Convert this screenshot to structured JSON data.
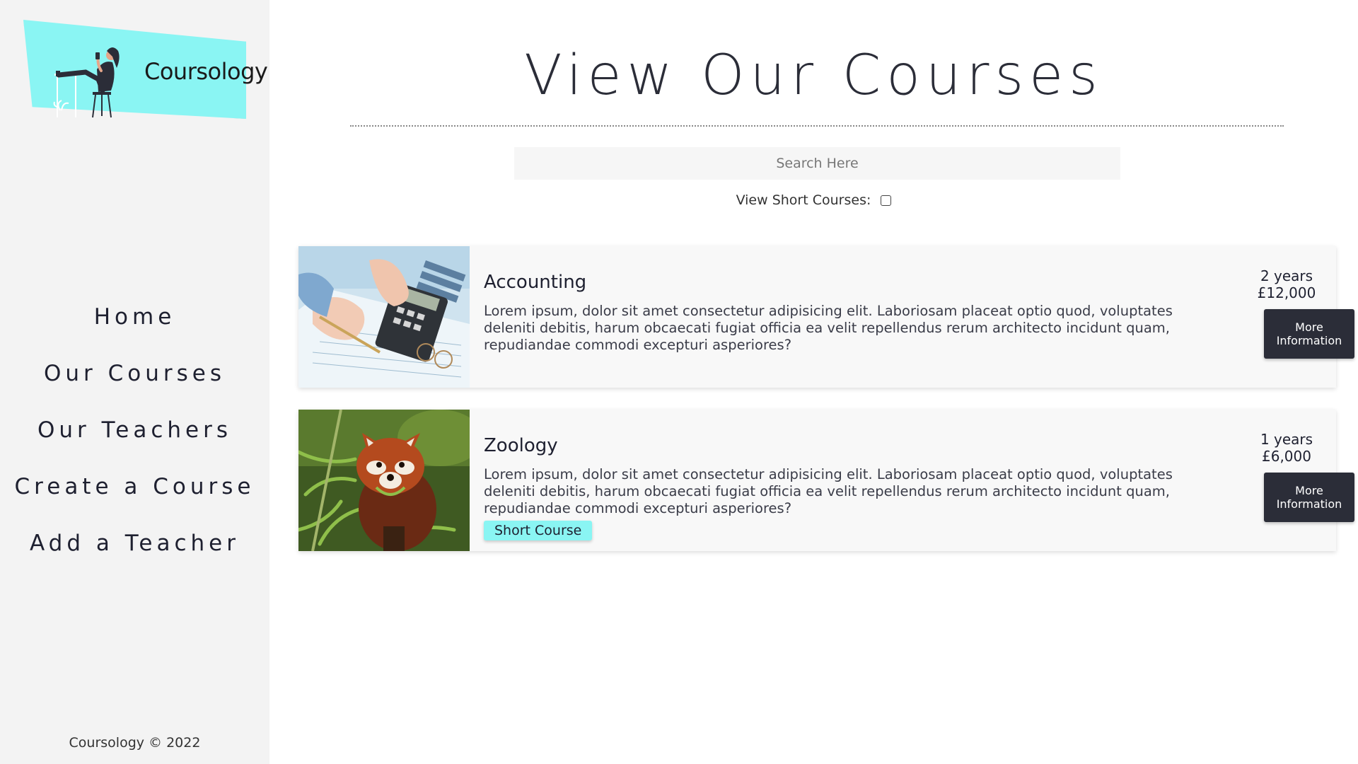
{
  "brand": {
    "name": "Coursology",
    "accent": "#8af5f3",
    "dark": "#2b2d38"
  },
  "nav": {
    "items": [
      {
        "label": "Home"
      },
      {
        "label": "Our Courses"
      },
      {
        "label": "Our Teachers"
      },
      {
        "label": "Create a Course"
      },
      {
        "label": "Add a Teacher"
      }
    ]
  },
  "footer": {
    "text": "Coursology © 2022"
  },
  "main": {
    "title": "View Our Courses",
    "search": {
      "placeholder": "Search Here",
      "value": ""
    },
    "short_toggle": {
      "label": "View Short Courses:",
      "checked": false
    }
  },
  "courses": [
    {
      "title": "Accounting",
      "image": "calculator-paperwork-photo",
      "description": "Lorem ipsum, dolor sit amet consectetur adipisicing elit. Laboriosam placeat optio quod, voluptates deleniti debitis, harum obcaecati fugiat officia ea velit repellendus rerum architecto incidunt quam, repudiandae commodi excepturi asperiores?",
      "duration": "2 years",
      "price": "£12,000",
      "badge": "",
      "button": "More Information"
    },
    {
      "title": "Zoology",
      "image": "red-panda-photo",
      "description": "Lorem ipsum, dolor sit amet consectetur adipisicing elit. Laboriosam placeat optio quod, voluptates deleniti debitis, harum obcaecati fugiat officia ea velit repellendus rerum architecto incidunt quam, repudiandae commodi excepturi asperiores?",
      "duration": "1 years",
      "price": "£6,000",
      "badge": "Short Course",
      "button": "More Information"
    }
  ]
}
